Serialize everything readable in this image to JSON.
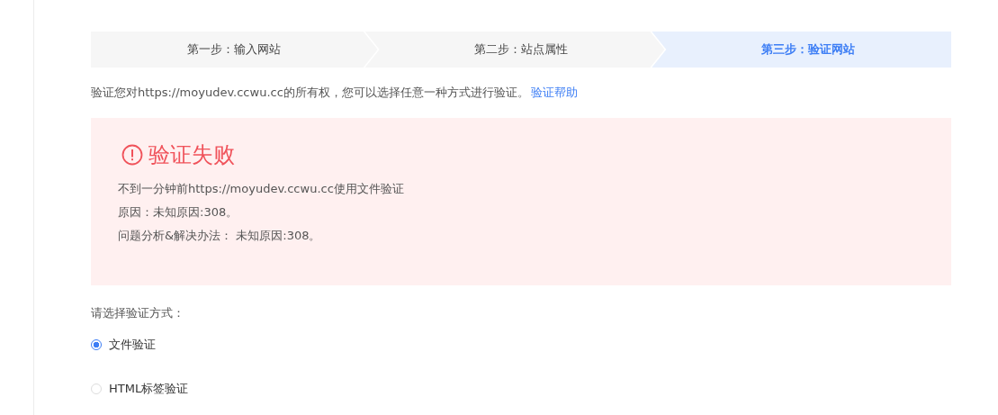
{
  "steps": [
    {
      "label": "第一步：输入网站",
      "selected": false
    },
    {
      "label": "第二步：站点属性",
      "selected": false
    },
    {
      "label": "第三步：验证网站",
      "selected": true
    }
  ],
  "intro": {
    "text": "验证您对https://moyudev.ccwu.cc的所有权，您可以选择任意一种方式进行验证。",
    "link": "验证帮助"
  },
  "result": {
    "title": "验证失败",
    "lines": [
      "不到一分钟前https://moyudev.ccwu.cc使用文件验证",
      "原因：未知原因:308。",
      "问题分析&解决办法： 未知原因:308。"
    ]
  },
  "methods": {
    "label": "请选择验证方式：",
    "options": [
      {
        "label": "文件验证",
        "selected": true
      },
      {
        "label": "HTML标签验证",
        "selected": false
      }
    ]
  }
}
